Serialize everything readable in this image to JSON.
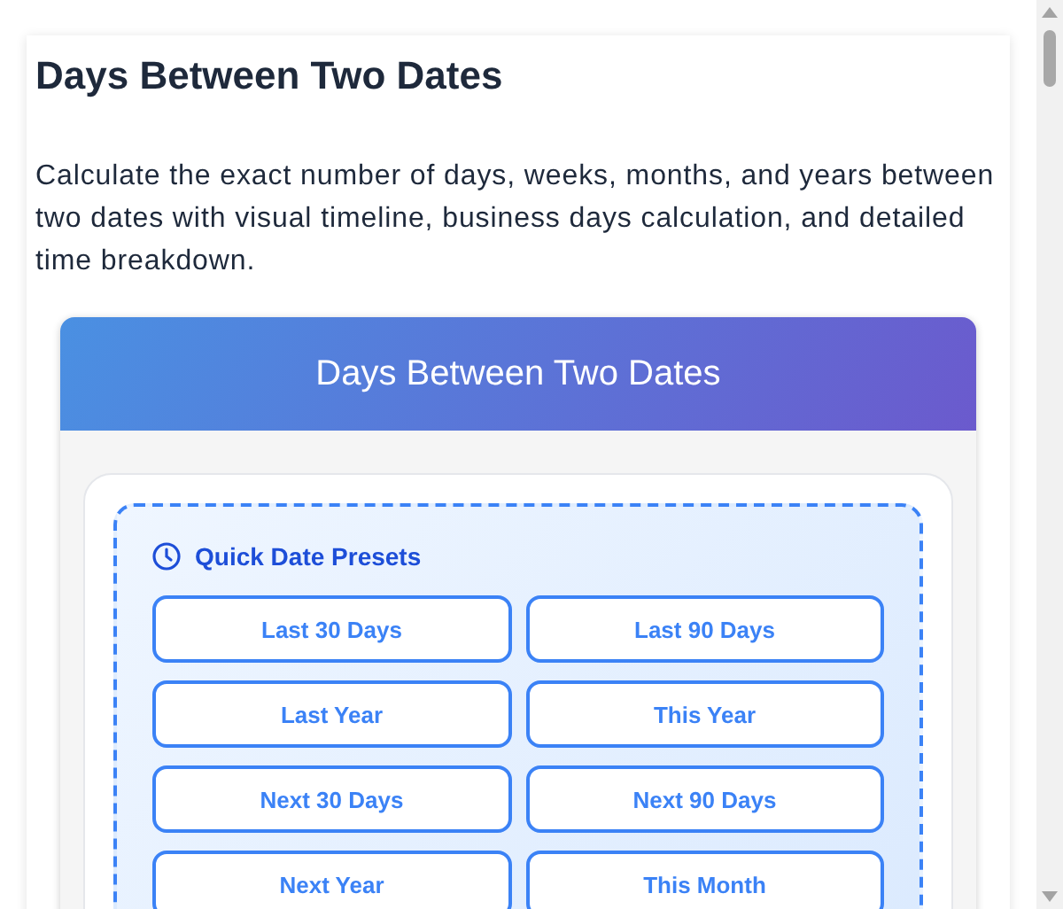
{
  "article": {
    "title": "Days Between Two Dates",
    "description": "Calculate the exact number of days, weeks, months, and years between two dates with visual timeline, business days calculation, and detailed time breakdown."
  },
  "calculator": {
    "header": "Days Between Two Dates",
    "presets": {
      "title": "Quick Date Presets",
      "buttons": [
        {
          "label": "Last 30 Days"
        },
        {
          "label": "Last 90 Days"
        },
        {
          "label": "Last Year"
        },
        {
          "label": "This Year"
        },
        {
          "label": "Next 30 Days"
        },
        {
          "label": "Next 90 Days"
        },
        {
          "label": "Next Year"
        },
        {
          "label": "This Month"
        }
      ]
    }
  }
}
